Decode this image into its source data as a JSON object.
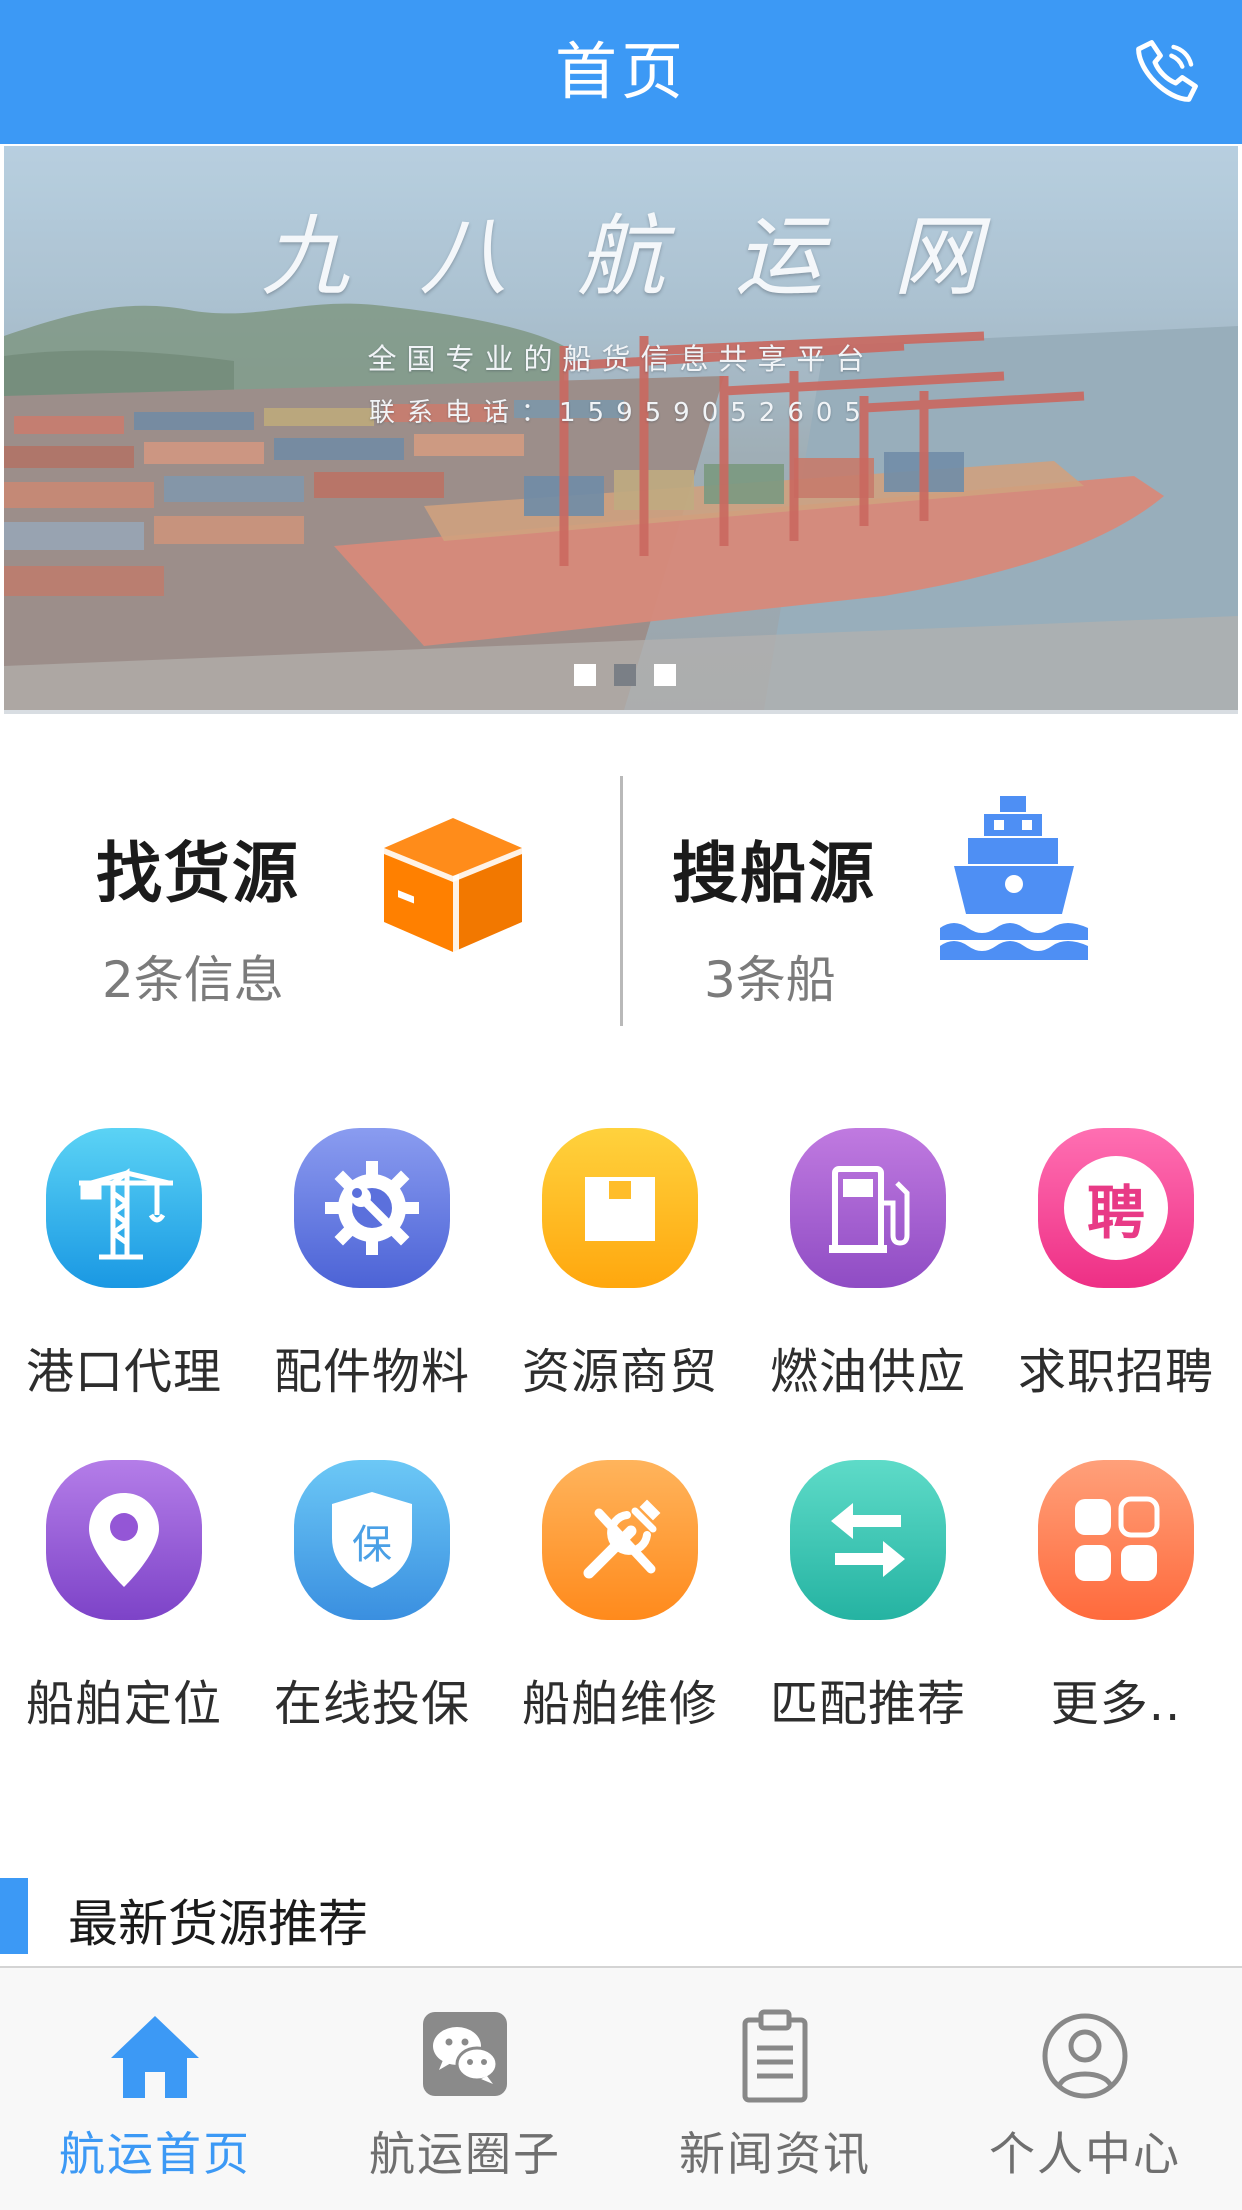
{
  "header": {
    "title": "首页",
    "phone_icon": "phone-icon"
  },
  "banner": {
    "title": "九八航运网",
    "subtitle": "全国专业的船货信息共享平台",
    "contact": "联系电话：15959052605",
    "slide_count": 3,
    "active_slide": 2
  },
  "quick": {
    "cargo": {
      "title": "找货源",
      "subtitle": "2条信息",
      "icon": "box-icon",
      "color": "#ff8000"
    },
    "ship": {
      "title": "搜船源",
      "subtitle": "3条船",
      "icon": "ship-icon",
      "color": "#4e8ff4"
    }
  },
  "grid": {
    "items": [
      {
        "label": "港口代理",
        "icon": "crane-icon"
      },
      {
        "label": "配件物料",
        "icon": "gear-wrench-icon"
      },
      {
        "label": "资源商贸",
        "icon": "package-icon"
      },
      {
        "label": "燃油供应",
        "icon": "fuel-pump-icon"
      },
      {
        "label": "求职招聘",
        "icon": "recruit-icon",
        "glyph": "聘"
      },
      {
        "label": "船舶定位",
        "icon": "location-pin-icon"
      },
      {
        "label": "在线投保",
        "icon": "shield-icon",
        "glyph": "保"
      },
      {
        "label": "船舶维修",
        "icon": "tools-icon"
      },
      {
        "label": "匹配推荐",
        "icon": "swap-arrows-icon"
      },
      {
        "label": "更多..",
        "icon": "more-grid-icon"
      }
    ]
  },
  "section": {
    "title": "最新货源推荐"
  },
  "tabbar": {
    "active": 0,
    "items": [
      {
        "label": "航运首页",
        "icon": "home-icon"
      },
      {
        "label": "航运圈子",
        "icon": "wechat-chat-icon"
      },
      {
        "label": "新闻资讯",
        "icon": "clipboard-icon"
      },
      {
        "label": "个人中心",
        "icon": "user-icon"
      }
    ]
  },
  "colors": {
    "primary": "#3c99f5",
    "cargo_orange": "#ff8000",
    "ship_blue": "#4e8ff4"
  }
}
